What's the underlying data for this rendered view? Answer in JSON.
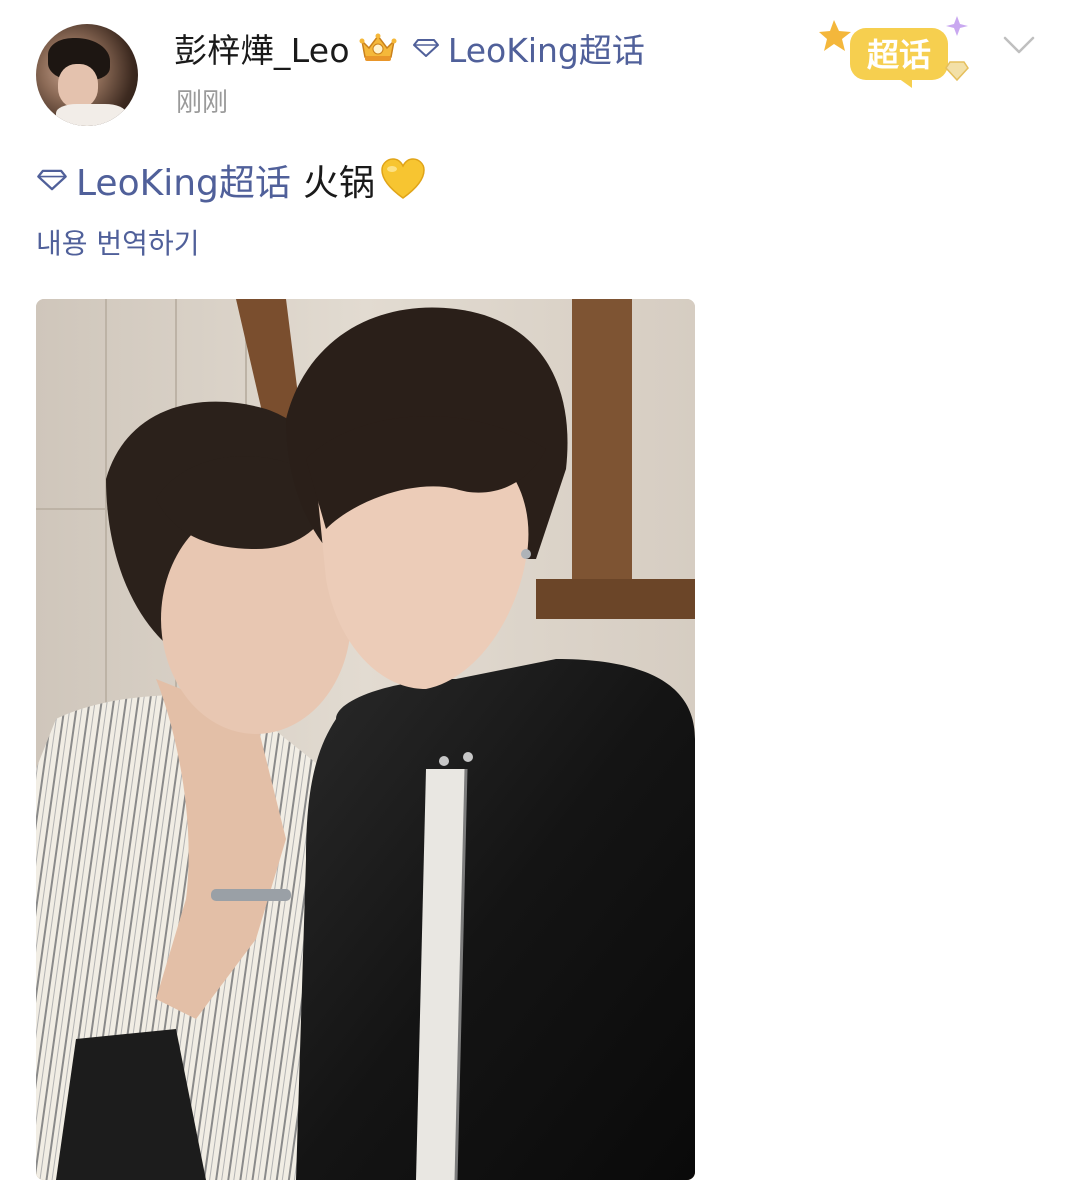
{
  "post": {
    "username": "彭梓燁_Leo",
    "header_topic": "LeoKing超话",
    "timestamp": "刚刚",
    "super_topic_badge": "超话",
    "text_topic": "LeoKing超话",
    "text_body": "火锅",
    "translate_label": "내용 번역하기"
  },
  "icons": {
    "crown": "crown-badge-icon",
    "topic": "diamond-icon",
    "heart": "yellow-heart-emoji",
    "menu": "chevron-down-icon",
    "badge": "super-topic-badge"
  },
  "colors": {
    "link": "#50609a",
    "username": "#1a1a1a",
    "timestamp": "#9a9a9a",
    "heart": "#f7c531",
    "badge": "#f6cf4f"
  }
}
